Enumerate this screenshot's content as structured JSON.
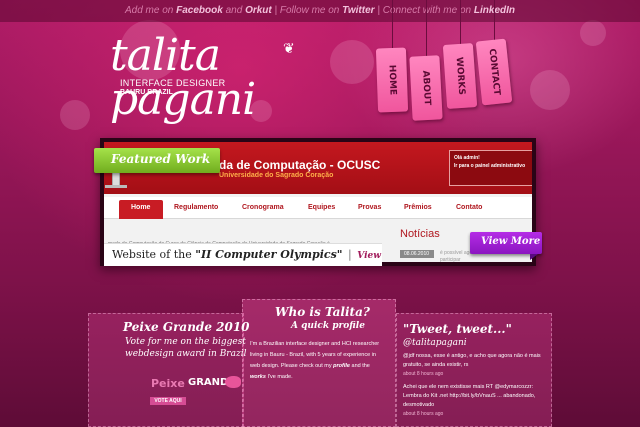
{
  "colors": {
    "background": "#9a175a",
    "tag": "#f0569d",
    "featured_label": "#8cc63f",
    "view_more": "#a020d0",
    "site_header_red": "#b8141b"
  },
  "top_links": {
    "prefix": "Add me on",
    "facebook": "Facebook",
    "and": "and",
    "orkut": "Orkut",
    "follow_text": "| Follow me on",
    "twitter": "Twitter",
    "connect_text": "| Connect with me on",
    "linkedin": "LinkedIn"
  },
  "logo": {
    "name": "talita pagani",
    "role": "INTERFACE DESIGNER",
    "city": "BAURU  BRAZIL",
    "ornament": "❦"
  },
  "tags": [
    {
      "label": "HOME"
    },
    {
      "label": "ABOUT"
    },
    {
      "label": "WORKS"
    },
    {
      "label": "CONTACT"
    }
  ],
  "featured": {
    "label": "Featured Work",
    "site_title": "da de Computação - OCUSC",
    "site_subtitle": "Universidade do Sagrado Coração",
    "admin_line1": "Olá admin!",
    "admin_line2": "Ir para o painel administrativo",
    "nav": [
      "Home",
      "Regulamento",
      "Cronograma",
      "Equipes",
      "Provas",
      "Prêmios",
      "Contato"
    ],
    "body_text": "mada de Computação do Curso de Ciência da Computação da Universidade do Sagrado Coração é",
    "news_heading": "Notícias",
    "news_date": "08.06.2010",
    "news_text_1": "é possível agora",
    "news_text_2": "participar",
    "caption_prefix": "Website of the",
    "caption_bold": "\"II Computer Olympics\"",
    "caption_sep": "|",
    "caption_view": "View",
    "view_more": "View More"
  },
  "panels": {
    "left": {
      "title": "Peixe Grande 2010",
      "line1": "Vote for me on the biggest",
      "line2": "webdesign award in Brazil",
      "badge_1": "Peixe",
      "badge_2": "GRANDE",
      "vote": "VOTE AQUI"
    },
    "middle": {
      "title": "Who is Talita?",
      "subtitle": "A quick profile",
      "line1": "I'm a Brazilian interface designer and HCI researcher",
      "line2": "living in Bauru - Brazil, with 5 years of experience in",
      "line3": "web design. Please check out my",
      "profile": "profile",
      "and_the": "and the",
      "works": "works",
      "end": "I've made."
    },
    "right": {
      "title": "\"Tweet, tweet...\"",
      "handle": "@talitapagani",
      "tweet1a": "@jdf nossa, esse é antigo, e acho que agora não é mais",
      "tweet1b": "gratuito, se ainda existir, rs",
      "tweet1_meta": "about 8 hours ago",
      "tweet2a": "Achei que ele nem existisse mais RT @edymarcozzr:",
      "tweet2b": "Lembra do Kit .net http://bit.ly/bVnauS ... abandonado,",
      "tweet2c": "desmotivado",
      "tweet2_meta": "about 8 hours ago"
    }
  }
}
